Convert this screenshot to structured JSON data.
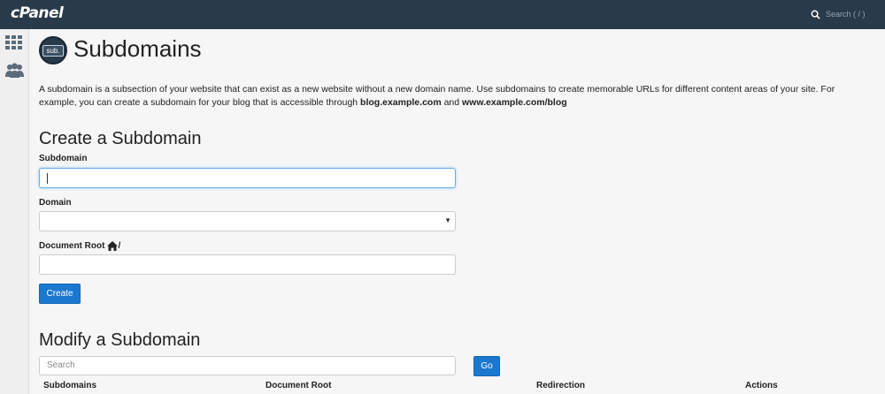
{
  "topbar": {
    "logo": "cPanel",
    "search_label": "Search ( / )",
    "search_icon": "search-icon"
  },
  "sidebar": {
    "items": [
      {
        "icon": "grid-icon"
      },
      {
        "icon": "users-icon"
      }
    ]
  },
  "page": {
    "icon_text": "sub.",
    "title": "Subdomains",
    "description_part1": "A subdomain is a subsection of your website that can exist as a new website without a new domain name. Use subdomains to create memorable URLs for different content areas of your site. For example, you can create a subdomain for your blog that is accessible through ",
    "description_bold1": "blog.example.com",
    "description_and": " and ",
    "description_bold2": "www.example.com/blog"
  },
  "create": {
    "heading": "Create a Subdomain",
    "subdomain_label": "Subdomain",
    "subdomain_value": "",
    "domain_label": "Domain",
    "domain_value": "",
    "docroot_label": "Document Root",
    "docroot_suffix": "/",
    "docroot_value": "",
    "create_button": "Create"
  },
  "modify": {
    "heading": "Modify a Subdomain",
    "search_placeholder": "Search",
    "go_button": "Go",
    "columns": [
      "Subdomains",
      "Document Root",
      "Redirection",
      "Actions"
    ]
  }
}
